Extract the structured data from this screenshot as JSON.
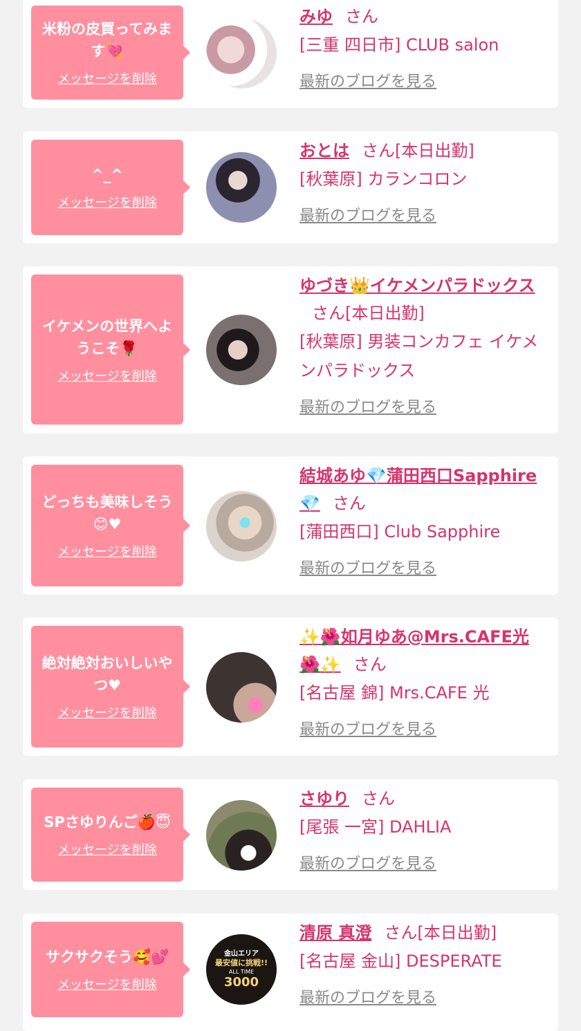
{
  "delete_label": "メッセージを削除",
  "blog_label": "最新のブログを見る",
  "san": "さん",
  "cards": [
    {
      "message": "米粉の皮買ってみます💘",
      "name": "みゆ",
      "status": "",
      "shop": "[三重 四日市] CLUB salon",
      "avatar_color": "#d8b4bc"
    },
    {
      "message": "^_^",
      "name": "おとは",
      "status": "[本日出勤]",
      "shop": "[秋葉原] カランコロン",
      "avatar_color": "#6a6f89"
    },
    {
      "message": "イケメンの世界へようこそ🌹",
      "name": "ゆづき👑イケメンパラドックス",
      "status": "[本日出勤]",
      "shop": "[秋葉原] 男装コンカフェ イケメンパラドックス",
      "avatar_color": "#4a4044"
    },
    {
      "message": "どっちも美味しそう😊♥",
      "name": "結城あゆ💎蒲田西口Sapphire💎",
      "status": "",
      "shop": "[蒲田西口] Club Sapphire",
      "avatar_color": "#c9b8ad"
    },
    {
      "message": "絶対絶対おいしいやつ♥",
      "name": "✨🌺如月ゆあ@Mrs.CAFE光🌺✨",
      "status": "",
      "shop": "[名古屋 錦] Mrs.CAFE 光",
      "avatar_color": "#3d3432"
    },
    {
      "message": "SPさゆりんご🍎😇",
      "name": "さゆり",
      "status": "",
      "shop": "[尾張 一宮] DAHLIA",
      "avatar_color": "#5d5a4c"
    },
    {
      "message": "サクサクそう🥰💕",
      "name": "清原 真澄",
      "status": "[本日出勤]",
      "shop": "[名古屋 金山] DESPERATE",
      "avatar_color": "#2a2320",
      "avatar_banner": [
        "金山エリア",
        "最安値に挑戦!!",
        "ALL TIME",
        "3000"
      ]
    }
  ]
}
